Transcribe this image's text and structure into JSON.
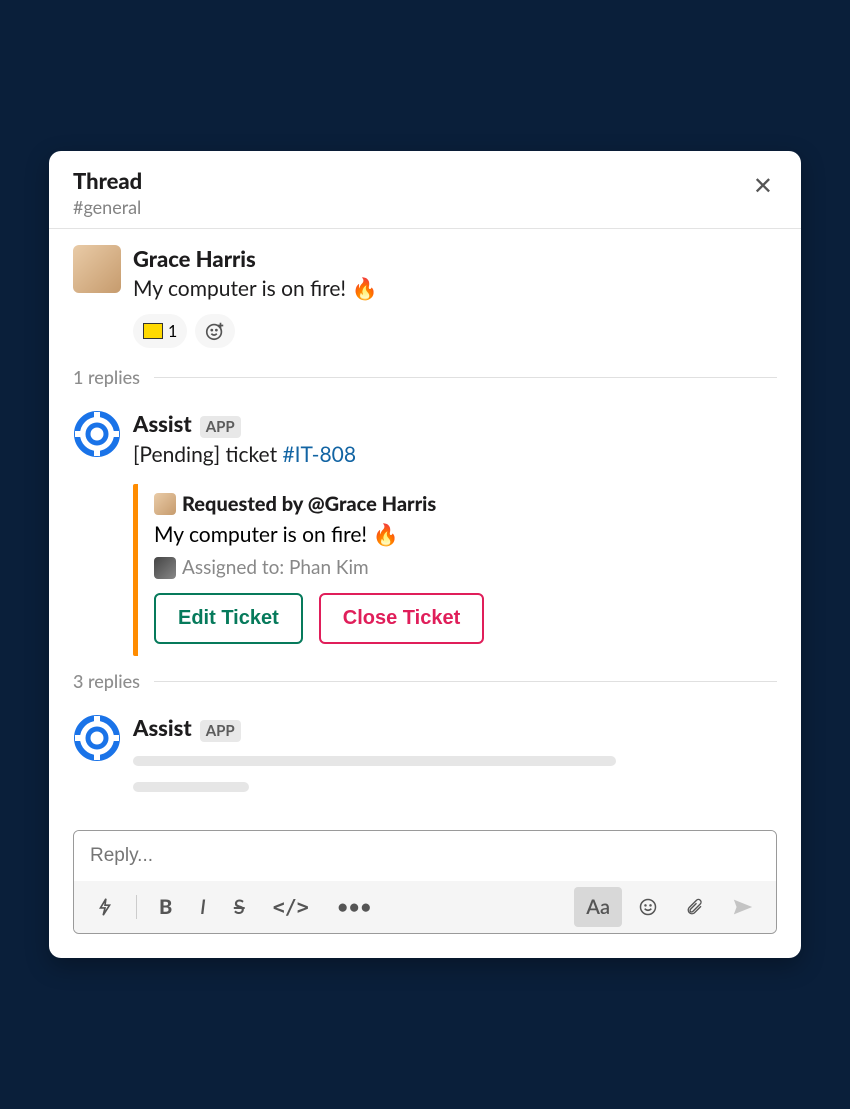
{
  "header": {
    "title": "Thread",
    "channel": "#general"
  },
  "message1": {
    "author": "Grace Harris",
    "text": "My computer is on fire! 🔥",
    "reaction_count": "1"
  },
  "divider1": "1 replies",
  "message2": {
    "author": "Assist",
    "app_label": "APP",
    "text_prefix": "[Pending] ticket ",
    "text_link": "#IT-808"
  },
  "attachment": {
    "requested_by": "Requested by @Grace Harris",
    "body": "My computer is on fire! 🔥",
    "assigned": "Assigned to: Phan Kim",
    "btn_edit": "Edit Ticket",
    "btn_close": "Close Ticket"
  },
  "divider2": "3 replies",
  "message3": {
    "author": "Assist",
    "app_label": "APP"
  },
  "composer": {
    "placeholder": "Reply..."
  }
}
